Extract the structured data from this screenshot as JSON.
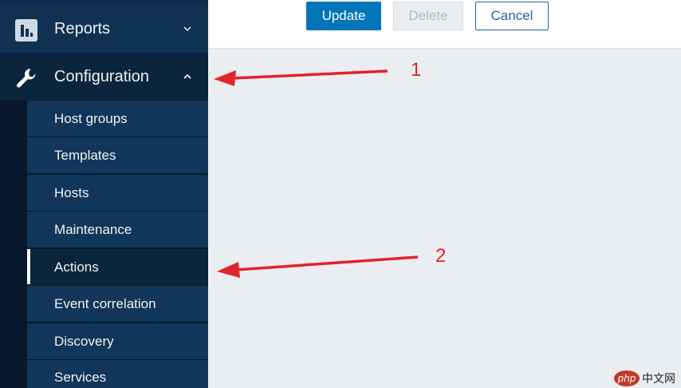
{
  "sidebar": {
    "reports": {
      "label": "Reports",
      "icon": "bar-chart-icon",
      "chevron": "chevron-down-icon"
    },
    "configuration": {
      "label": "Configuration",
      "icon": "wrench-icon",
      "chevron": "chevron-up-icon"
    },
    "items": [
      {
        "label": "Host groups"
      },
      {
        "label": "Templates"
      },
      {
        "label": "Hosts"
      },
      {
        "label": "Maintenance"
      },
      {
        "label": "Actions",
        "selected": true
      },
      {
        "label": "Event correlation"
      },
      {
        "label": "Discovery"
      },
      {
        "label": "Services"
      }
    ]
  },
  "toolbar": {
    "update_label": "Update",
    "delete_label": "Delete",
    "cancel_label": "Cancel"
  },
  "annotations": {
    "label_1": "1",
    "label_2": "2",
    "color": "#e0242b"
  },
  "colors": {
    "sidebar_bg": "#0e2d47",
    "accent": "#0275b8",
    "content_bg": "#ebeef0"
  },
  "watermark": {
    "badge": "php",
    "text": "中文网"
  }
}
